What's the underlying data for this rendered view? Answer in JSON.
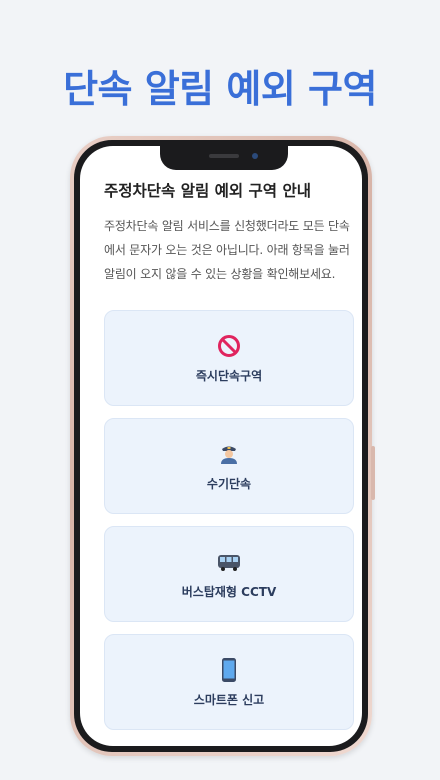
{
  "hero_title": "단속 알림 예외 구역",
  "screen": {
    "title": "주정차단속 알림 예외 구역 안내",
    "description": "주정차단속 알림 서비스를 신청했더라도 모든 단속에서 문자가 오는 것은 아닙니다. 아래 항목을 눌러 알림이 오지 않을 수 있는 상황을 확인해보세요.",
    "items": [
      {
        "label": "즉시단속구역",
        "icon": "no-entry-icon"
      },
      {
        "label": "수기단속",
        "icon": "police-officer-icon"
      },
      {
        "label": "버스탑재형 CCTV",
        "icon": "bus-icon"
      },
      {
        "label": "스마트폰 신고",
        "icon": "smartphone-icon"
      }
    ]
  },
  "colors": {
    "accent": "#3a6fd8",
    "card_bg": "#ecf3fc",
    "background": "#f2f4f7"
  }
}
